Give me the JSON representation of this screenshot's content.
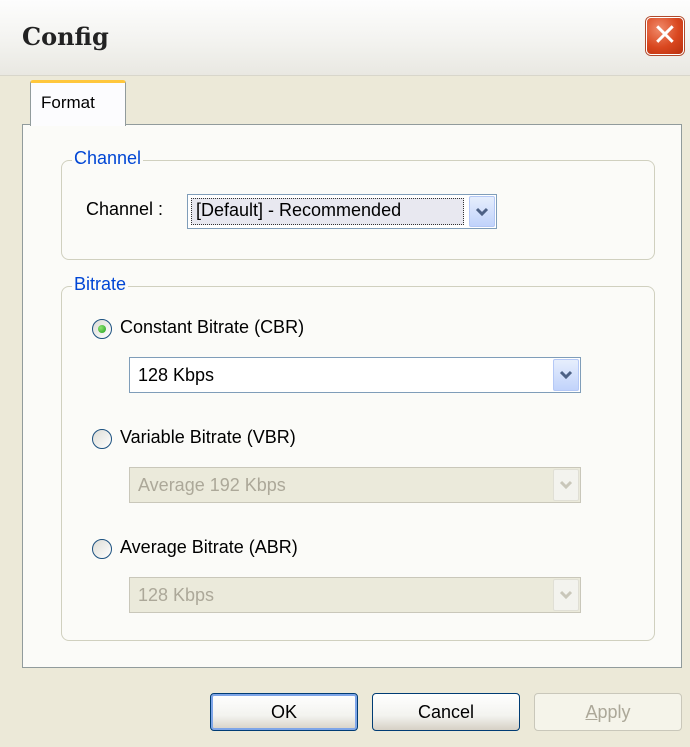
{
  "window": {
    "title": "Config",
    "close_glyph": "✕"
  },
  "tabs": [
    {
      "label": "Format",
      "selected": true
    }
  ],
  "channel_group": {
    "legend": "Channel",
    "label": "Channel :",
    "selected_value": "[Default] - Recommended"
  },
  "bitrate_group": {
    "legend": "Bitrate",
    "options": [
      {
        "label": "Constant Bitrate (CBR)",
        "checked": true,
        "dropdown_value": "128 Kbps",
        "enabled": true
      },
      {
        "label": "Variable Bitrate (VBR)",
        "checked": false,
        "dropdown_value": "Average 192 Kbps",
        "enabled": false
      },
      {
        "label": "Average Bitrate (ABR)",
        "checked": false,
        "dropdown_value": "128 Kbps",
        "enabled": false
      }
    ]
  },
  "buttons": {
    "ok": "OK",
    "cancel": "Cancel",
    "apply_prefix": "",
    "apply_mnemonic": "A",
    "apply_rest": "pply"
  },
  "icons": {
    "dropdown": "chevron-down-icon",
    "close": "close-icon"
  },
  "colors": {
    "legend_text": "#0046d5",
    "tab_highlight": "#ffc73c",
    "close_button": "#d9471f",
    "radio_dot": "#21a121"
  }
}
